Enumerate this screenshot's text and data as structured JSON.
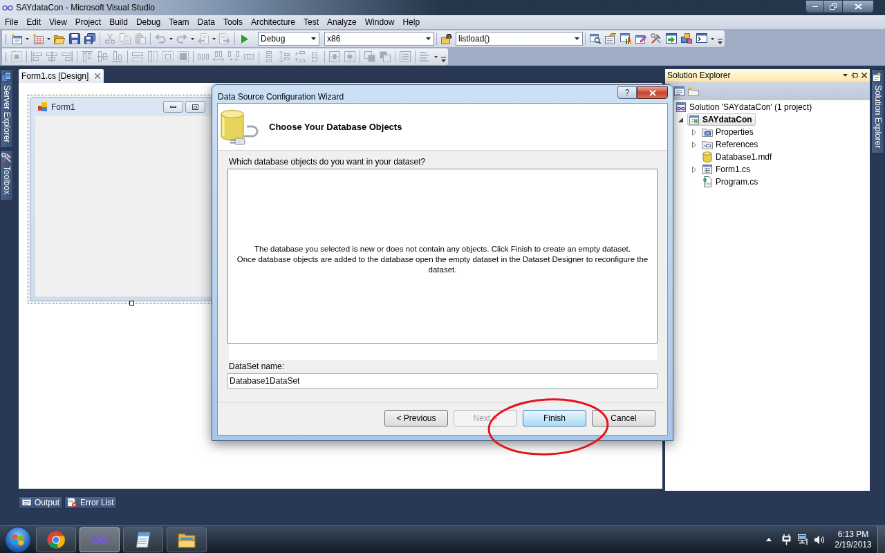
{
  "window": {
    "title": "SAYdataCon - Microsoft Visual Studio"
  },
  "menu_bar": [
    "File",
    "Edit",
    "View",
    "Project",
    "Build",
    "Debug",
    "Team",
    "Data",
    "Tools",
    "Architecture",
    "Test",
    "Analyze",
    "Window",
    "Help"
  ],
  "standard_toolbar": {
    "buttons": [
      {
        "kind": "newproject",
        "disabled": false
      },
      {
        "kind": "additem",
        "disabled": false
      },
      {
        "kind": "open",
        "disabled": false
      },
      {
        "kind": "save",
        "disabled": false
      },
      {
        "kind": "saveall",
        "disabled": false
      },
      {
        "kind": "cut",
        "disabled": true
      },
      {
        "kind": "copy",
        "disabled": true
      },
      {
        "kind": "paste",
        "disabled": true
      },
      {
        "kind": "undo",
        "disabled": true
      },
      {
        "kind": "redo",
        "disabled": true
      },
      {
        "kind": "navback",
        "disabled": true
      },
      {
        "kind": "navforward",
        "disabled": true
      },
      {
        "kind": "start",
        "disabled": false
      }
    ],
    "configuration": "Debug",
    "platform": "x86",
    "find_text": "listload()",
    "window_buttons": [
      {
        "kind": "findresults",
        "disabled": false
      },
      {
        "kind": "properties",
        "disabled": false
      },
      {
        "kind": "chart",
        "disabled": false
      },
      {
        "kind": "edit",
        "disabled": false
      },
      {
        "kind": "toolbox",
        "disabled": false
      },
      {
        "kind": "startpage",
        "disabled": false
      },
      {
        "kind": "extensions",
        "disabled": false
      },
      {
        "kind": "command",
        "disabled": false
      }
    ]
  },
  "layout_toolbar": {
    "disabled": true
  },
  "left_dock_tabs": [
    {
      "label": "Server Explorer",
      "kind": "server"
    },
    {
      "label": "Toolbox",
      "kind": "toolbox"
    }
  ],
  "document_tabs": [
    {
      "label": "Form1.cs [Design]",
      "selected": true
    }
  ],
  "designer": {
    "form_title": "Form1"
  },
  "bottom_dock_tabs": [
    {
      "label": "Output",
      "kind": "output"
    },
    {
      "label": "Error List",
      "kind": "errors"
    }
  ],
  "solution_explorer": {
    "title": "Solution Explorer",
    "tree": [
      {
        "label": "Solution 'SAYdataCon' (1 project)",
        "kind": "solution",
        "selected": false,
        "children": [
          {
            "label": "SAYdataCon",
            "kind": "project",
            "selected": true,
            "startup_project": true,
            "expanded": true,
            "children": [
              {
                "label": "Properties",
                "kind": "properties",
                "selected": false,
                "expanded": false
              },
              {
                "label": "References",
                "kind": "references",
                "selected": false,
                "expanded": false
              },
              {
                "label": "Database1.mdf",
                "kind": "database",
                "selected": false
              },
              {
                "label": "Form1.cs",
                "kind": "form",
                "selected": false,
                "expanded": false
              },
              {
                "label": "Program.cs",
                "kind": "code",
                "selected": false
              }
            ]
          }
        ]
      }
    ]
  },
  "right_dock_tabs": [
    {
      "label": "Solution Explorer",
      "kind": "solution"
    }
  ],
  "dialog": {
    "title": "Data Source Configuration Wizard",
    "help_glyph": "?",
    "heading": "Choose Your Database Objects",
    "prompt": "Which database objects do you want in your dataset?",
    "message": [
      "The database you selected is new or does not contain any objects. Click Finish to create an empty dataset.",
      "Once database objects are added to the database open the empty dataset in the Dataset Designer to reconfigure the dataset."
    ],
    "dataset_label": "DataSet name:",
    "dataset_name": "Database1DataSet",
    "buttons": [
      {
        "label": "< Previous",
        "disabled": false,
        "default": false
      },
      {
        "label": "Next >",
        "disabled": true,
        "default": false
      },
      {
        "label": "Finish",
        "disabled": false,
        "default": true
      },
      {
        "label": "Cancel",
        "disabled": false,
        "default": false
      }
    ]
  },
  "annotation": {
    "kind": "ellipse"
  },
  "taskbar": {
    "apps": [
      {
        "kind": "browser",
        "selected": false
      },
      {
        "kind": "ide",
        "selected": true
      },
      {
        "kind": "notepad",
        "selected": false
      },
      {
        "kind": "files",
        "selected": false
      }
    ],
    "time": "6:13 PM",
    "date": "2/19/2013"
  }
}
